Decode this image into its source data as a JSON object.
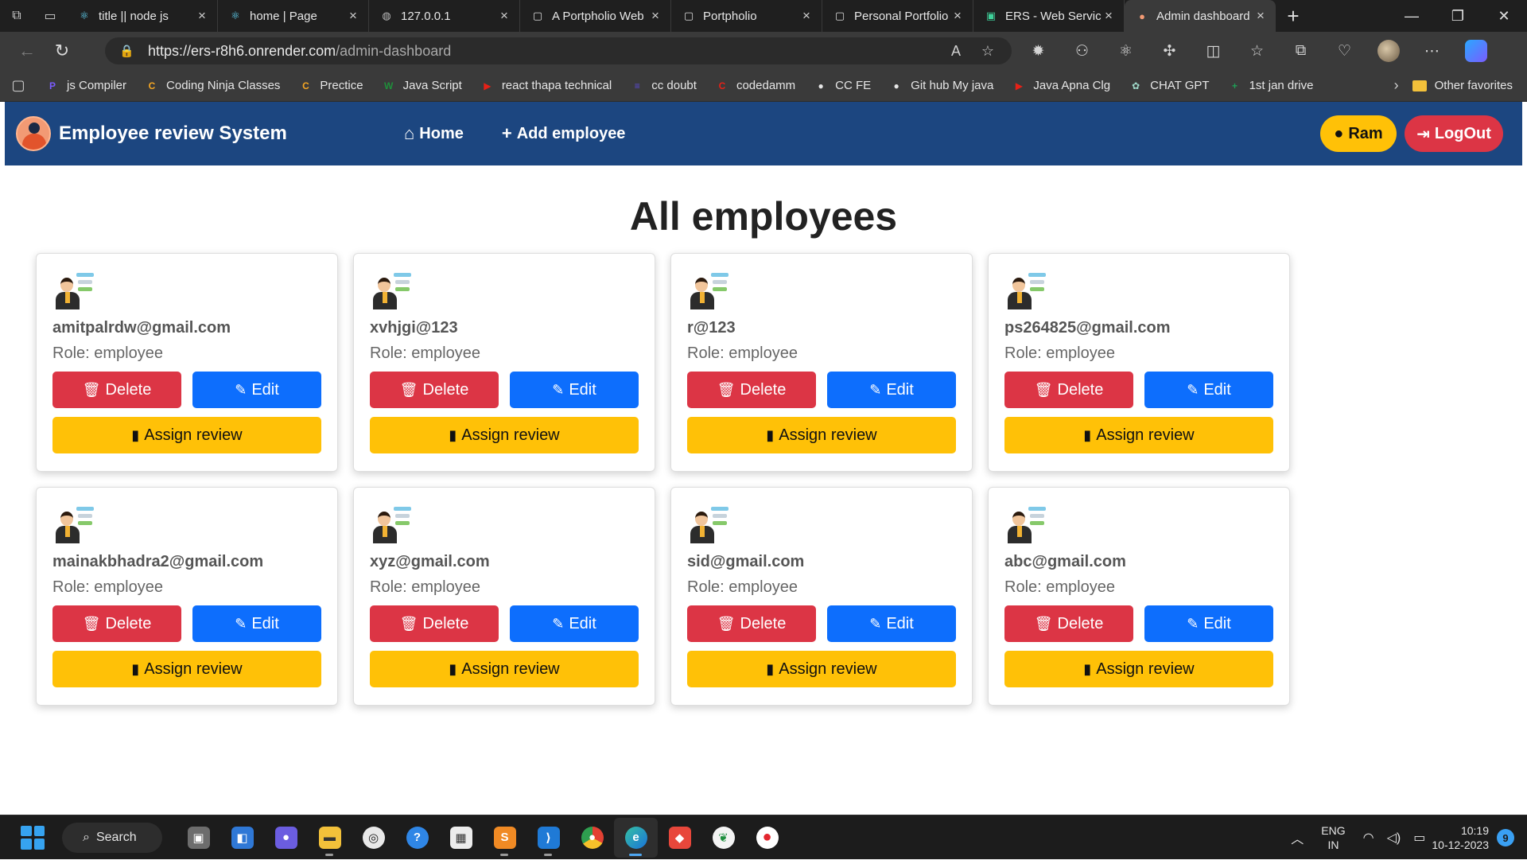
{
  "browser": {
    "tabs": [
      {
        "title": "title || node js",
        "icon": "react-icon",
        "active": false
      },
      {
        "title": "home | Page",
        "icon": "react-icon",
        "active": false
      },
      {
        "title": "127.0.0.1",
        "icon": "globe-icon",
        "active": false
      },
      {
        "title": "A Portpholio Web",
        "icon": "page-icon",
        "active": false
      },
      {
        "title": "Portpholio",
        "icon": "page-icon",
        "active": false
      },
      {
        "title": "Personal Portfolio",
        "icon": "page-icon",
        "active": false
      },
      {
        "title": "ERS - Web Service",
        "icon": "render-icon",
        "active": false
      },
      {
        "title": "Admin dashboard",
        "icon": "site-logo-icon",
        "active": true
      }
    ],
    "url_host": "https://ers-r8h6.onrender.com",
    "url_path": "/admin-dashboard",
    "bookmarks": [
      {
        "label": "js Compiler",
        "color": "#7b5cff",
        "glyph": "P"
      },
      {
        "label": "Coding Ninja Classes",
        "color": "#f5a623",
        "glyph": "C"
      },
      {
        "label": "Prectice",
        "color": "#f5a623",
        "glyph": "C"
      },
      {
        "label": "Java Script",
        "color": "#1f8f3a",
        "glyph": "W"
      },
      {
        "label": "react thapa technical",
        "color": "#e62117",
        "glyph": "▶"
      },
      {
        "label": "cc doubt",
        "color": "#5b4bd6",
        "glyph": "≡"
      },
      {
        "label": "codedamm",
        "color": "#e62117",
        "glyph": "C"
      },
      {
        "label": "CC FE",
        "color": "#e6e6e6",
        "glyph": "●"
      },
      {
        "label": "Git hub My java",
        "color": "#e6e6e6",
        "glyph": "●"
      },
      {
        "label": "Java Apna Clg",
        "color": "#e62117",
        "glyph": "▶"
      },
      {
        "label": "CHAT GPT",
        "color": "#9fd8c8",
        "glyph": "✿"
      },
      {
        "label": "1st jan drive",
        "color": "#1f9d55",
        "glyph": "+"
      }
    ],
    "other_favorites": "Other favorites"
  },
  "app": {
    "brand": "Employee review System",
    "nav": {
      "home": "Home",
      "add_employee": "Add employee"
    },
    "user_name": "Ram",
    "logout": "LogOut",
    "heading": "All employees",
    "labels": {
      "delete": "Delete",
      "edit": "Edit",
      "assign": "Assign review"
    },
    "employees": [
      {
        "email": "amitpalrdw@gmail.com",
        "role": "Role: employee"
      },
      {
        "email": "xvhjgi@123",
        "role": "Role: employee"
      },
      {
        "email": "r@123",
        "role": "Role: employee"
      },
      {
        "email": "ps264825@gmail.com",
        "role": "Role: employee"
      },
      {
        "email": "mainakbhadra2@gmail.com",
        "role": "Role: employee"
      },
      {
        "email": "xyz@gmail.com",
        "role": "Role: employee"
      },
      {
        "email": "sid@gmail.com",
        "role": "Role: employee"
      },
      {
        "email": "abc@gmail.com",
        "role": "Role: employee"
      }
    ],
    "colors": {
      "navbar": "#1c4680",
      "danger": "#dc3545",
      "primary": "#0d6efd",
      "warning": "#ffc107"
    }
  },
  "taskbar": {
    "search": "Search",
    "lang_top": "ENG",
    "lang_bottom": "IN",
    "time": "10:19",
    "date": "10-12-2023",
    "notifications": "9"
  }
}
